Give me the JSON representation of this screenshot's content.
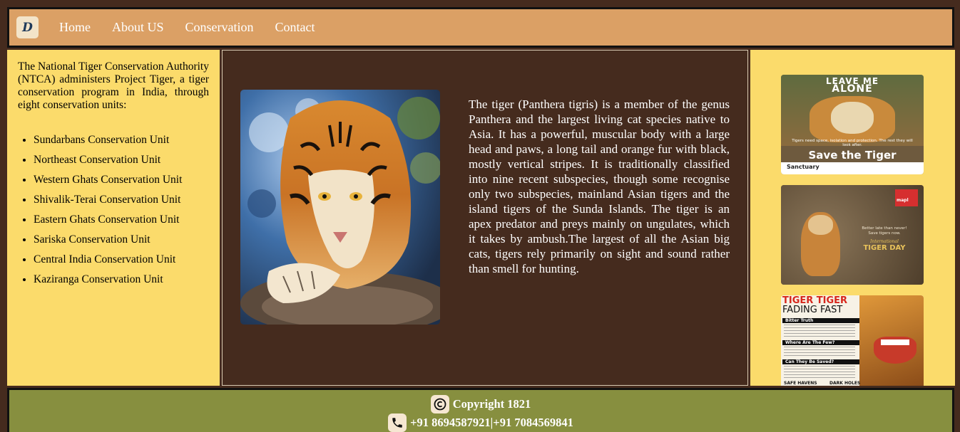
{
  "header": {
    "logo_text": "D",
    "nav": [
      "Home",
      "About US",
      "Conservation",
      "Contact"
    ]
  },
  "sidebar": {
    "intro": "The National Tiger Conservation Authority (NTCA) administers Project Tiger, a tiger conservation program in India, through eight conservation units:",
    "units": [
      "Sundarbans Conservation Unit",
      "Northeast Conservation Unit",
      "Western Ghats Conservation Unit",
      "Shivalik-Terai Conservation Unit",
      "Eastern Ghats Conservation Unit",
      "Sariska Conservation Unit",
      "Central India Conservation Unit",
      "Kaziranga Conservation Unit"
    ]
  },
  "main": {
    "description": "The tiger (Panthera tigris) is a member of the genus Panthera and the largest living cat species native to Asia. It has a powerful, muscular body with a large head and paws, a long tail and orange fur with black, mostly vertical stripes. It is traditionally classified into nine recent subspecies, though some recognise only two subspecies, mainland Asian tigers and the island tigers of the Sunda Islands. The tiger is an apex predator and preys mainly on ungulates, which it takes by ambush.The largest of all the Asian big cats, tigers rely primarily on sight and sound rather than smell for hunting."
  },
  "posters": {
    "p1": {
      "top": "LEAVE ME",
      "top2": "ALONE",
      "small": "Tigers need space, isolation and protection. The rest they will look after.",
      "title": "Save the Tiger",
      "brand": "Sanctuary"
    },
    "p2": {
      "brand": "mapl",
      "tag1": "Better late than never!",
      "tag2": "Save tigers now.",
      "small": "International",
      "title": "TIGER DAY"
    },
    "p3": {
      "title1": "TIGER TIGER",
      "title2": "FADING FAST",
      "h1": "Bitter Truth",
      "h2": "Where Are The Few?",
      "h3": "Can They Be Saved?",
      "f1": "SAFE HAVENS",
      "f2": "DARK HOLES"
    }
  },
  "footer": {
    "copyright": "Copyright 1821",
    "phones": "+91 8694587921|+91 7084569841"
  },
  "colors": {
    "header_bg": "#dba065",
    "sidebar_bg": "#fbdb6b",
    "content_bg": "#452b1e",
    "footer_bg": "#878f3f"
  }
}
